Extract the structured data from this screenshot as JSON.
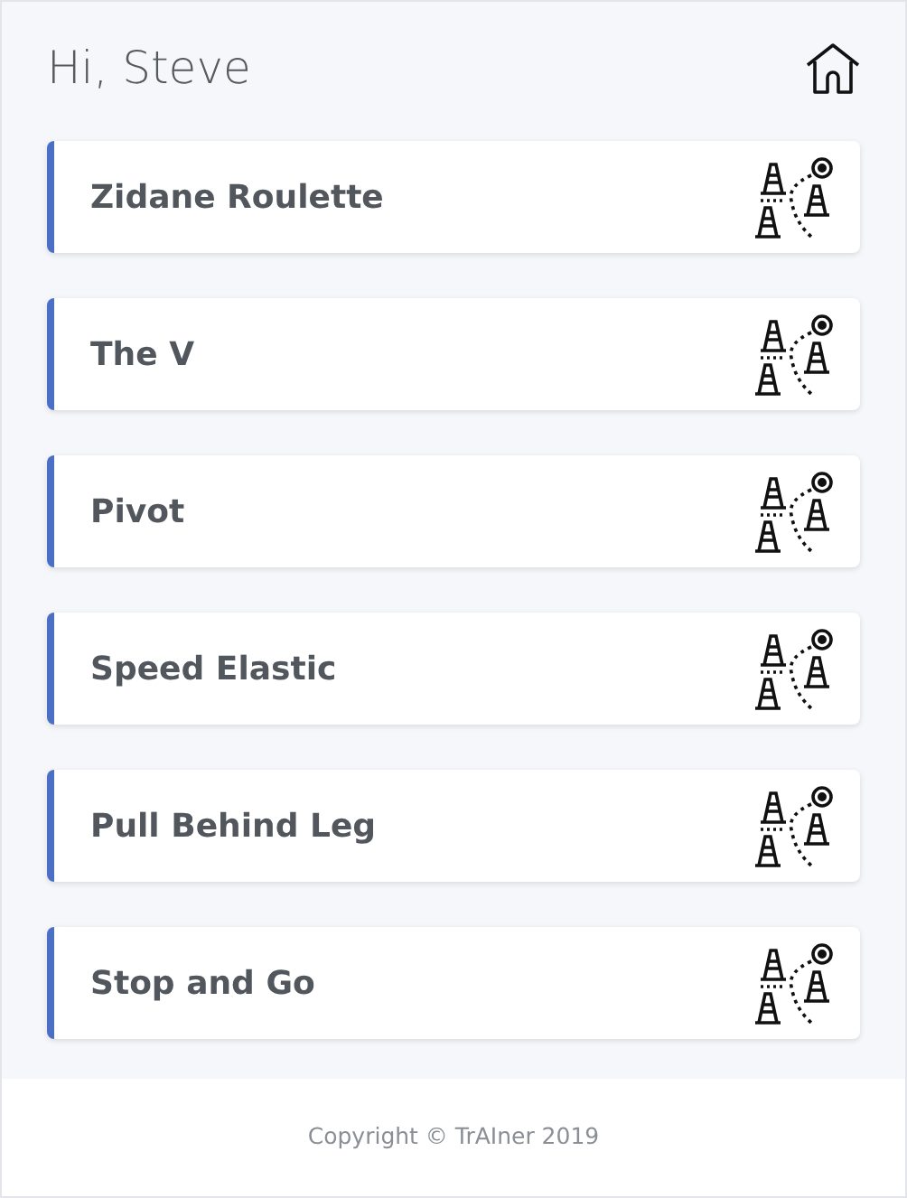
{
  "header": {
    "greeting": "Hi, Steve"
  },
  "drills": [
    {
      "name": "Zidane Roulette"
    },
    {
      "name": "The V"
    },
    {
      "name": "Pivot"
    },
    {
      "name": "Speed Elastic"
    },
    {
      "name": "Pull Behind Leg"
    },
    {
      "name": "Stop and Go"
    }
  ],
  "footer": {
    "copyright": "Copyright © TrAIner 2019"
  }
}
